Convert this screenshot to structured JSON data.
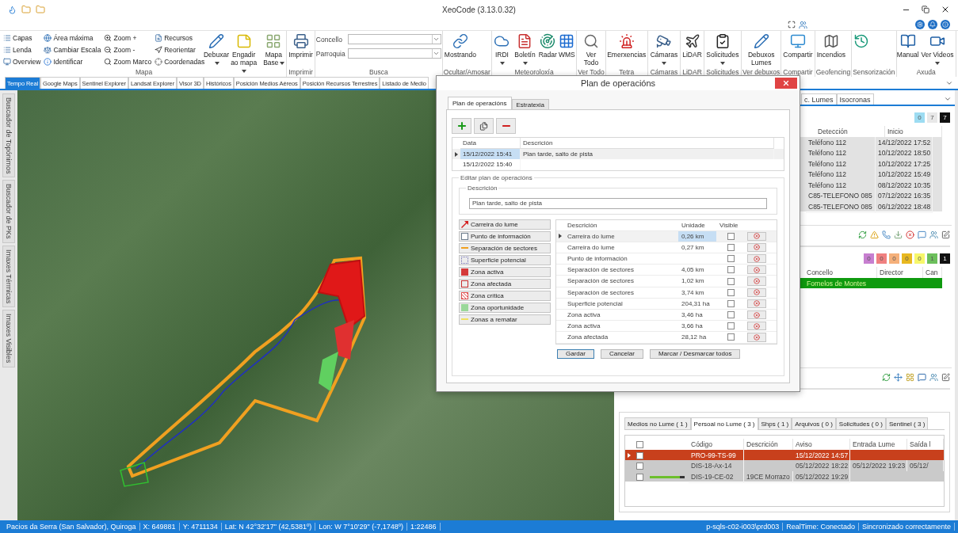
{
  "window": {
    "title": "XeoCode (3.13.0.32)"
  },
  "ribbon": {
    "groups": [
      {
        "label": "Mapa",
        "small_columns": [
          [
            "Capas",
            "Lenda",
            "Overview"
          ],
          [
            "Área máxima",
            "Cambiar Escala",
            "Identificar"
          ],
          [
            "Zoom +",
            "Zoom -",
            "Zoom Marco"
          ],
          [
            "Recursos",
            "Reorientar",
            "Coordenadas"
          ]
        ],
        "buttons": [
          {
            "label": "Debuxar",
            "dropdown": true
          },
          {
            "label": "Engadir ao mapa",
            "dropdown": true
          },
          {
            "label": "Mapa Base",
            "dropdown": true
          }
        ]
      },
      {
        "label": "Imprimir",
        "buttons": [
          {
            "label": "Imprimir",
            "dropdown": false
          }
        ]
      },
      {
        "label": "Busca",
        "fields": [
          {
            "label": "Concello"
          },
          {
            "label": "Parroquia"
          }
        ]
      },
      {
        "label": "Ocultar/Amosar",
        "buttons": [
          {
            "label": "Mostrando",
            "dropdown": false
          }
        ]
      },
      {
        "label": "Meteoroloxía",
        "buttons": [
          {
            "label": "IRDI",
            "dropdown": true
          },
          {
            "label": "Boletín",
            "dropdown": true
          },
          {
            "label": "Radar",
            "dropdown": false
          },
          {
            "label": "WMS",
            "dropdown": false
          }
        ]
      },
      {
        "label": "Ver Todo",
        "buttons": [
          {
            "label": "Ver Todo",
            "dropdown": false
          }
        ]
      },
      {
        "label": "Tetra",
        "buttons": [
          {
            "label": "Emerxencias",
            "dropdown": false
          }
        ]
      },
      {
        "label": "Cámaras",
        "buttons": [
          {
            "label": "Cámaras",
            "dropdown": true
          }
        ]
      },
      {
        "label": "LiDAR",
        "buttons": [
          {
            "label": "LiDAR",
            "dropdown": false
          }
        ]
      },
      {
        "label": "Solicitudes",
        "buttons": [
          {
            "label": "Solicitudes",
            "dropdown": true
          }
        ]
      },
      {
        "label": "Ver debuxos",
        "buttons": [
          {
            "label": "Debuxos Lumes",
            "dropdown": false
          }
        ]
      },
      {
        "label": "Compartir",
        "buttons": [
          {
            "label": "Compartir",
            "dropdown": false
          }
        ]
      },
      {
        "label": "Geofencing",
        "buttons": [
          {
            "label": "Incendios",
            "dropdown": false
          }
        ]
      },
      {
        "label": "Sensorización",
        "buttons": [
          {
            "dropdown": false
          }
        ]
      },
      {
        "label": "Axuda",
        "buttons": [
          {
            "label": "Manual",
            "dropdown": false
          },
          {
            "label": "Ver Videos",
            "dropdown": true
          }
        ]
      }
    ]
  },
  "map_tabs": [
    {
      "label": "Tempo Real",
      "selected": true
    },
    {
      "label": "Google Maps",
      "selected": false
    },
    {
      "label": "Sentinel Explorer",
      "selected": false
    },
    {
      "label": "Landsat Explorer",
      "selected": false
    },
    {
      "label": "Visor 3D",
      "selected": false
    },
    {
      "label": "Históricos",
      "selected": false
    },
    {
      "label": "Posición Medios Aéreos",
      "selected": false
    },
    {
      "label": "Posición Recursos Terrestres",
      "selected": false
    },
    {
      "label": "Listado de Medio",
      "selected": false
    }
  ],
  "side_tabs": [
    "Buscador de Topónimos",
    "Buscador de PKs",
    "Imaxes Térmicas",
    "Imaxes Visibles"
  ],
  "right_panel": {
    "tabs": [
      {
        "label": "c. Lumes",
        "selected": false
      },
      {
        "label": "Isocronas",
        "selected": false
      }
    ],
    "fires": {
      "counters": [
        {
          "value": "0",
          "color": "#9ddcf2"
        },
        {
          "value": "7",
          "color": "#e8e8e8"
        },
        {
          "value": "7",
          "color": "#111111"
        }
      ],
      "columns": [
        "Detección",
        "Inicio"
      ],
      "rows": [
        [
          "Teléfono 112",
          "14/12/2022 17:52"
        ],
        [
          "Teléfono 112",
          "10/12/2022 18:50"
        ],
        [
          "Teléfono 112",
          "10/12/2022 17:25"
        ],
        [
          "Teléfono 112",
          "10/12/2022 15:49"
        ],
        [
          "Teléfono 112",
          "08/12/2022 10:35"
        ],
        [
          "C85-TELEFONO 085",
          "07/12/2022 16:35"
        ],
        [
          "C85-TELEFONO 085",
          "06/12/2022 18:48"
        ]
      ]
    },
    "incidents": {
      "counters": [
        {
          "value": "0",
          "color": "#c77fd0"
        },
        {
          "value": "0",
          "color": "#f08080"
        },
        {
          "value": "0",
          "color": "#f5b07a"
        },
        {
          "value": "0",
          "color": "#e8b820"
        },
        {
          "value": "0",
          "color": "#f7f76a"
        },
        {
          "value": "1",
          "color": "#6cbf5c"
        },
        {
          "value": "1",
          "color": "#111111"
        }
      ],
      "columns": [
        "Concello",
        "Director",
        "Can"
      ],
      "rows": [
        {
          "concello": "Fornelos de Montes",
          "color": "#0f9a0f"
        }
      ]
    },
    "bottom": {
      "tabs": [
        {
          "label": "Medios no Lume ( 1 )",
          "selected": false
        },
        {
          "label": "Persoal no Lume ( 3 )",
          "selected": true
        },
        {
          "label": "Shps ( 1 )",
          "selected": false
        },
        {
          "label": "Arquivos ( 0 )",
          "selected": false
        },
        {
          "label": "Solicitudes ( 0 )",
          "selected": false
        },
        {
          "label": "Sentinel ( 3 )",
          "selected": false
        }
      ],
      "all_checked": false,
      "columns": [
        "Código",
        "Descrición",
        "Aviso",
        "Entrada Lume",
        "Saída l"
      ],
      "rows": [
        {
          "code": "PRO-99-TS-99",
          "notice": "15/12/2022 14:57",
          "color": "#c8401c",
          "checked": false,
          "selected": true,
          "indicator": false
        },
        {
          "code": "DIS-18-Ax-14",
          "notice": "05/12/2022 18:22",
          "entry": "05/12/2022 19:23",
          "exit": "05/12/",
          "color": "#cacaca",
          "checked": false,
          "selected": false,
          "indicator": false
        },
        {
          "code": "DIS-19-CE-02",
          "description": "19CE Morrazo",
          "notice": "05/12/2022 19:29",
          "color": "#cacaca",
          "checked": false,
          "selected": false,
          "indicator": true
        }
      ]
    }
  },
  "dialog": {
    "title": "Plan de operacións",
    "tabs": [
      {
        "label": "Plan de operacións",
        "selected": true
      },
      {
        "label": "Estratexia",
        "selected": false
      }
    ],
    "plans": {
      "columns": [
        "Data",
        "Descrición"
      ],
      "rows": [
        {
          "date": "15/12/2022 15:41",
          "description": "Plan tarde, salto de pista",
          "selected": true
        },
        {
          "date": "15/12/2022 15:40",
          "selected": false
        }
      ]
    },
    "edit_title": "Editar plan de operacións",
    "description_label": "Descrición",
    "description_value": "Plan tarde, salto de pista",
    "palette": [
      {
        "label": "Carreira do lume",
        "kind": "arrow",
        "color": "#d42020"
      },
      {
        "label": "Punto de información",
        "kind": "note",
        "color": "#6c7c8c"
      },
      {
        "label": "Separación de sectores",
        "kind": "line",
        "color": "#f0a020"
      },
      {
        "label": "Superficie potencial",
        "kind": "dotted",
        "color": "#6868b0"
      },
      {
        "label": "Zona activa",
        "kind": "fill",
        "color": "#d43a3a"
      },
      {
        "label": "Zona afectada",
        "kind": "outline",
        "color": "#c83030"
      },
      {
        "label": "Zona crítica",
        "kind": "cross",
        "color": "#e05050"
      },
      {
        "label": "Zona oportunidade",
        "kind": "fill",
        "color": "#9ad89a"
      },
      {
        "label": "Zonas a rematar",
        "kind": "line",
        "color": "#f0e060"
      }
    ],
    "elements": {
      "columns": [
        "Descrición",
        "Unidade",
        "Visible"
      ],
      "rows": [
        {
          "description": "Carreira do lume",
          "unit": "0,26 km",
          "visible": false,
          "selected": true
        },
        {
          "description": "Carreira do lume",
          "unit": "0,27 km",
          "visible": false,
          "selected": false
        },
        {
          "description": "Punto de información",
          "visible": false,
          "selected": false
        },
        {
          "description": "Separación de sectores",
          "unit": "4,05 km",
          "visible": false,
          "selected": false
        },
        {
          "description": "Separación de sectores",
          "unit": "1,02 km",
          "visible": false,
          "selected": false
        },
        {
          "description": "Separación de sectores",
          "unit": "3,74 km",
          "visible": false,
          "selected": false
        },
        {
          "description": "Superficie potencial",
          "unit": "204,31 ha",
          "visible": false,
          "selected": false
        },
        {
          "description": "Zona activa",
          "unit": "3,46 ha",
          "visible": false,
          "selected": false
        },
        {
          "description": "Zona activa",
          "unit": "3,66 ha",
          "visible": false,
          "selected": false
        },
        {
          "description": "Zona afectada",
          "unit": "28,12 ha",
          "visible": false,
          "selected": false
        }
      ]
    },
    "buttons": [
      "Gardar",
      "Cancelar",
      "Marcar / Desmarcar todos"
    ]
  },
  "status_bar": {
    "left": [
      "Pacios da Serra (San Salvador), Quiroga",
      "X: 649881",
      "Y: 4711134",
      "Lat: N 42°32'17\" (42,5381º)",
      "Lon: W 7°10'29\" (-7,1748º)",
      "1:22486"
    ],
    "right": [
      "p-sqls-c02-i003\\prd003",
      "RealTime: Conectado",
      "Sincronizado correctamente"
    ]
  }
}
